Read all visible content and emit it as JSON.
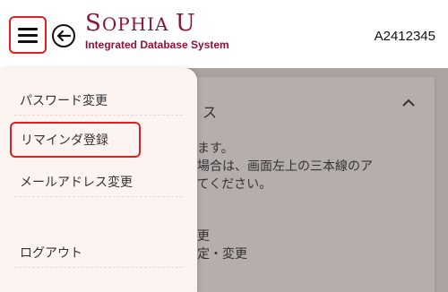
{
  "header": {
    "logo_title_big_s": "S",
    "logo_title_rest1": "OPHIA ",
    "logo_title_u": "U",
    "logo_subtitle": "Integrated Database System",
    "user_id": "A2412345"
  },
  "drawer": {
    "items": [
      {
        "label": "パスワード変更"
      },
      {
        "label": "リマインダ登録"
      },
      {
        "label": "メールアドレス変更"
      },
      {
        "label": "ログアウト"
      }
    ]
  },
  "main": {
    "card_title_fragment": "ス",
    "body_lines": [
      "きます。",
      "い場合は、画面左上の三本線のア",
      "してください。"
    ],
    "list_lines": [
      "定",
      "変更",
      "設定・変更"
    ]
  },
  "colors": {
    "brand": "#8b1538",
    "highlight": "#e02020",
    "drawer_bg": "#fdf3f1"
  }
}
